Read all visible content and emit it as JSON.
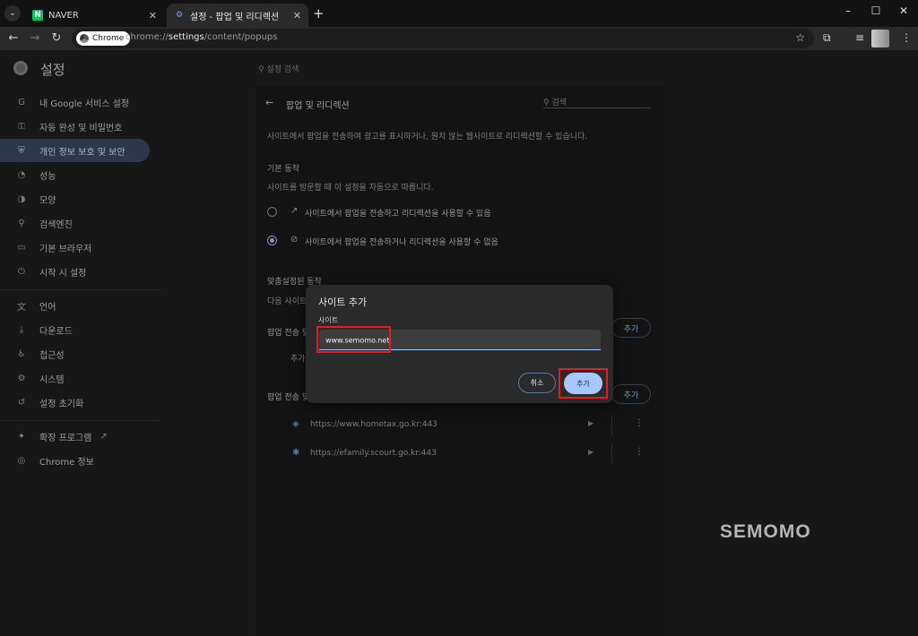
{
  "browser": {
    "tabs": [
      {
        "label": "NAVER",
        "favicon": "N"
      },
      {
        "label": "설정 - 팝업 및 리디렉션",
        "favicon": "gear"
      }
    ],
    "new_tab": "+",
    "window_controls": {
      "minimize": "–",
      "maximize": "☐",
      "close": "✕"
    },
    "chip": "Chrome",
    "url_prefix": "chrome://",
    "url_host": "settings",
    "url_path": "/content/popups"
  },
  "header": {
    "title": "설정",
    "search_placeholder": "설정 검색"
  },
  "sidebar": {
    "items": [
      {
        "label": "내 Google 서비스 설정",
        "icon": "G"
      },
      {
        "label": "자동 완성 및 비밀번호",
        "icon": "⚿"
      },
      {
        "label": "개인 정보 보호 및 보안",
        "icon": "⛨"
      },
      {
        "label": "성능",
        "icon": "◔"
      },
      {
        "label": "모양",
        "icon": "◑"
      },
      {
        "label": "검색엔진",
        "icon": "⚲"
      },
      {
        "label": "기본 브라우저",
        "icon": "▭"
      },
      {
        "label": "시작 시 설정",
        "icon": "⏻"
      },
      {
        "label": "언어",
        "icon": "文"
      },
      {
        "label": "다운로드",
        "icon": "⤓"
      },
      {
        "label": "접근성",
        "icon": "♿"
      },
      {
        "label": "시스템",
        "icon": "⚙"
      },
      {
        "label": "설정 초기화",
        "icon": "↺"
      },
      {
        "label": "확장 프로그램",
        "icon": "✦",
        "external": "↗"
      },
      {
        "label": "Chrome 정보",
        "icon": "◎"
      }
    ]
  },
  "content": {
    "title": "팝업 및 리디렉션",
    "search_placeholder": "검색",
    "description": "사이트에서 팝업을 전송하여 광고를 표시하거나, 원치 않는 웹사이트로 리디렉션할 수 있습니다.",
    "default_heading": "기본 동작",
    "default_sub": "사이트를 방문할 때 이 설정을 자동으로 따릅니다.",
    "options": [
      {
        "label": "사이트에서 팝업을 전송하고 리디렉션을 사용할 수 있음",
        "icon": "↗"
      },
      {
        "label": "사이트에서 팝업을 전송하거나 리디렉션을 사용할 수 없음",
        "icon": "⊘"
      }
    ],
    "custom_heading": "맞춤설정된 동작",
    "custom_sub_partial": "다음 사이트",
    "allow_label_partial": "팝업 전송 및",
    "no_sites_partial": "추가",
    "block_label_partial": "팝업 전송 및",
    "add_label": "추가",
    "blocked_sites": [
      {
        "url": "https://www.hometax.go.kr:443"
      },
      {
        "url": "https://efamily.scourt.go.kr:443"
      }
    ]
  },
  "dialog": {
    "title": "사이트 추가",
    "field_label": "사이트",
    "input_value": "www.semomo.net",
    "cancel_label": "취소",
    "add_label": "추가"
  },
  "watermark": "SEMOMO",
  "colors": {
    "accent": "#a8c7fa",
    "highlight": "#e21b24",
    "active_nav": "#3b4a66"
  }
}
